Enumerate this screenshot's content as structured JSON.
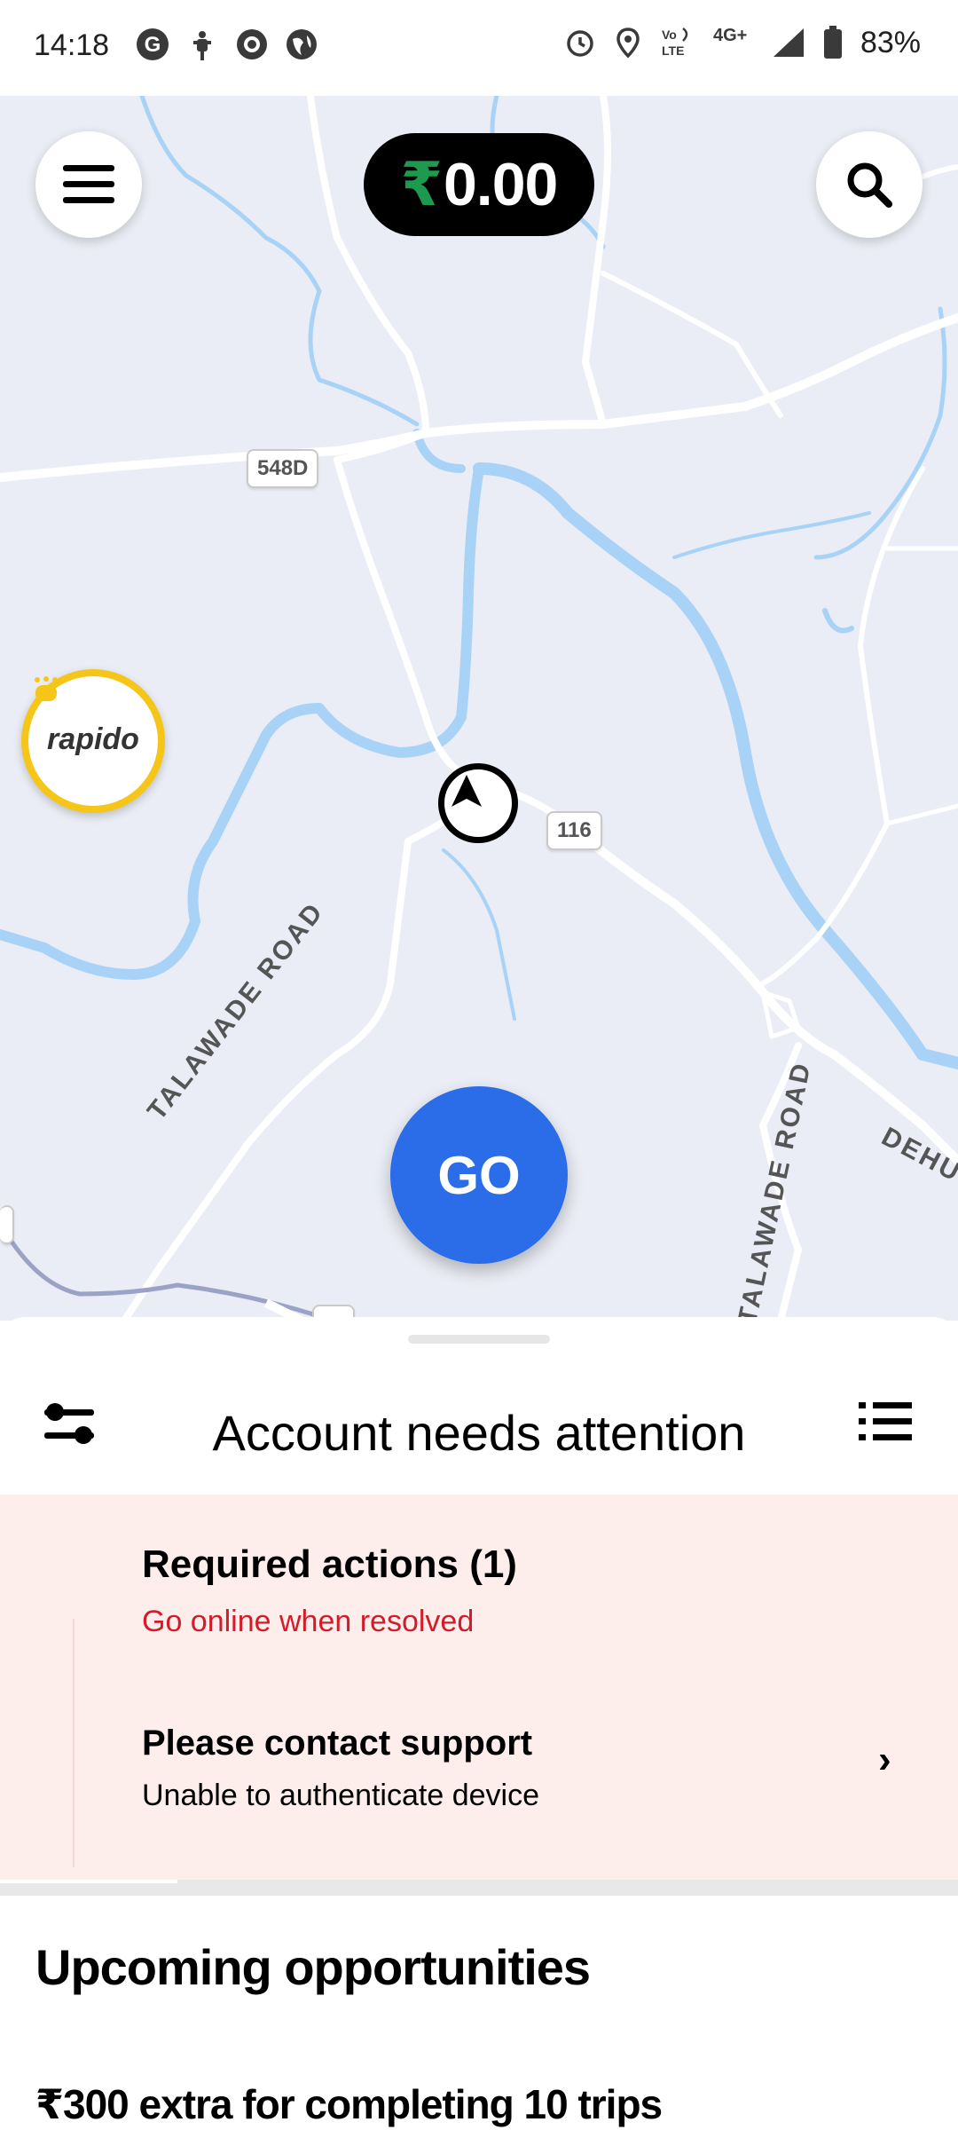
{
  "status_bar": {
    "time": "14:18",
    "left_icons": [
      "google-icon",
      "scooter-icon",
      "circle-app-icon",
      "globe-icon"
    ],
    "right_icons": [
      "alarm-icon",
      "location-pin-icon",
      "volte-icon",
      "4g-signal-icon",
      "signal-icon",
      "battery-icon"
    ],
    "network": "4G+",
    "volte": "VoLTE",
    "battery": "83%"
  },
  "map": {
    "earnings": "0.00",
    "currency_symbol": "₹",
    "road_labels": [
      "TALAWADE ROAD",
      "TALAWADE ROAD",
      "DEHU"
    ],
    "shields": [
      "548D",
      "116"
    ],
    "go_label": "GO",
    "partner_logo": "rapido",
    "colors": {
      "map_bg": "#eaedf5",
      "water": "#a9d2f7",
      "road": "#ffffff",
      "go_button": "#2b6de8",
      "earnings_rupee": "#1e9a50"
    }
  },
  "sheet": {
    "title": "Account needs attention",
    "required_title": "Required actions (1)",
    "required_sub": "Go online when resolved",
    "support_title": "Please contact support",
    "support_sub": "Unable to authenticate device",
    "chevron": "›",
    "opportunities_title": "Upcoming opportunities",
    "promo_title": "₹300 extra for completing 10 trips",
    "colors": {
      "attention_bg": "#fdeeec",
      "alert_text": "#d21c2a"
    }
  }
}
